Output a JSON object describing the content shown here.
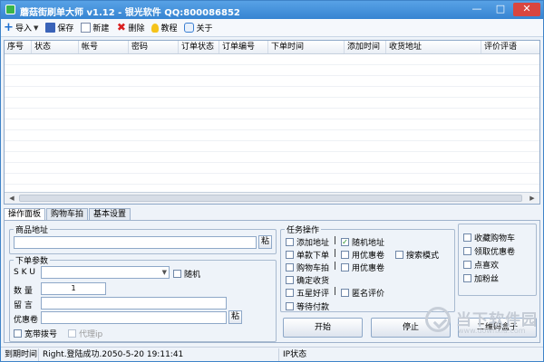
{
  "window": {
    "title": "蘑菇街刷单大师 v1.12 - 银光软件 QQ:800086852",
    "controls": {
      "minimize": "—",
      "maximize": "□",
      "close": "✕"
    }
  },
  "toolbar": {
    "import": "导入",
    "save": "保存",
    "new": "新建",
    "delete": "删除",
    "tutorial": "教程",
    "about": "关于"
  },
  "grid": {
    "columns": [
      "序号",
      "状态",
      "帐号",
      "密码",
      "订单状态",
      "订单编号",
      "下单时间",
      "添加时间",
      "收货地址",
      "评价评语"
    ]
  },
  "tabs": [
    "操作面板",
    "购物车拍",
    "基本设置"
  ],
  "product": {
    "legend": "商品地址",
    "url_value": "",
    "paste": "粘"
  },
  "order": {
    "legend": "下单参数",
    "sku_label": "S K U",
    "sku_value": "",
    "random": "随机",
    "qty_label": "数  量",
    "qty_value": "1",
    "message_label": "留  言",
    "message_value": "",
    "coupon_label": "优惠卷",
    "coupon_value": "",
    "coupon_paste": "粘",
    "broadband_dial": "宽带拨号",
    "proxy_ip": "代理ip"
  },
  "tasks": {
    "legend": "任务操作",
    "separator": "|",
    "items": {
      "add_address": "添加地址",
      "random_address": "随机地址",
      "single_order": "单款下单",
      "use_coupon_1": "用优惠卷",
      "search_mode": "搜索模式",
      "cart_order": "购物车拍",
      "use_coupon_2": "用优惠卷",
      "confirm_receipt": "确定收货",
      "five_star": "五星好评",
      "anonymous_review": "匿名评价",
      "wait_payment": "等待付款"
    },
    "checked": {
      "random_address": true
    }
  },
  "extra": {
    "favorite_cart": "收藏购物车",
    "claim_coupon": "领取优惠卷",
    "like": "点喜欢",
    "follow": "加粉丝"
  },
  "buttons": {
    "start": "开始",
    "stop": "停止",
    "qr_box": "二维码盒子"
  },
  "status": {
    "expire_label": "到期时间",
    "message": "Right.登陆成功.2050-5-20 19:11:41",
    "ip_status": "IP状态"
  },
  "watermark": {
    "brand": "当下软件园",
    "url": "www.downxia.com"
  },
  "colors": {
    "title_bar": "#3684d2",
    "window_bg": "#eef3f9",
    "accent_check": "#1a8a1a"
  }
}
